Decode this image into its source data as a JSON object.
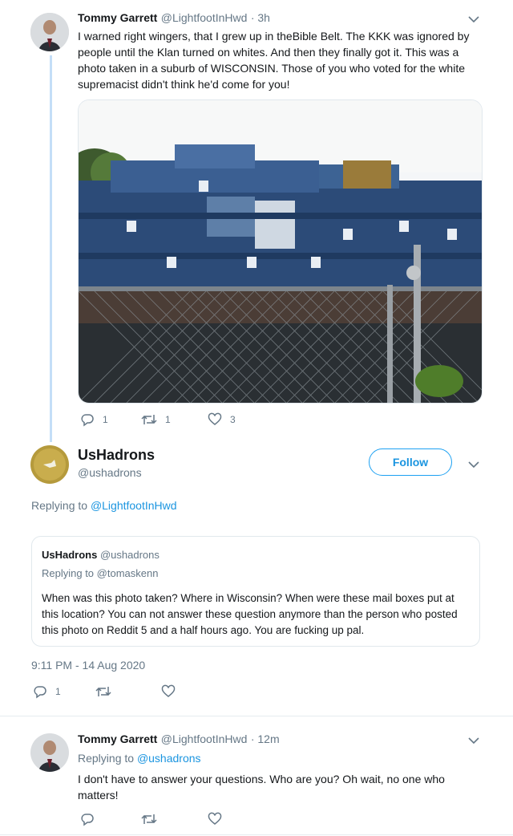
{
  "tweet1": {
    "name": "Tommy Garrett",
    "handle": "@LightfootInHwd",
    "time": "· 3h",
    "text": "I warned right wingers, that I grew up in theBible Belt.  The KKK was ignored by people until the Klan turned on whites. And then they finally got it. This was a photo taken in a suburb of WISCONSIN. Those of you who voted for the white supremacist didn't think he'd come for you!",
    "replies": "1",
    "retweets": "1",
    "likes": "3"
  },
  "main": {
    "name": "UsHadrons",
    "handle": "@ushadrons",
    "follow_label": "Follow",
    "replying_prefix": "Replying to",
    "replying_to": "@LightfootInHwd",
    "quote": {
      "name": "UsHadrons",
      "handle": "@ushadrons",
      "replying_prefix": "Replying to",
      "replying_to": "@tomaskenn",
      "text": "When was this photo taken? Where in Wisconsin? When were these mail boxes put at this location? You can not answer these question anymore than the person who posted this photo on Reddit 5 and a half hours ago. You are fucking up pal."
    },
    "timestamp": "9:11 PM - 14 Aug 2020",
    "replies": "1"
  },
  "tweet2": {
    "name": "Tommy Garrett",
    "handle": "@LightfootInHwd",
    "time": "· 12m",
    "replying_prefix": "Replying to",
    "replying_to": "@ushadrons",
    "text": "I don't have to answer your questions.  Who are you? Oh wait, no one who matters!"
  },
  "icons": [
    "reply-icon",
    "retweet-icon",
    "heart-icon",
    "chevron-down-icon"
  ],
  "colors": {
    "link": "#1b95e0",
    "gray": "#657786",
    "thread": "#c4def7",
    "follow_border": "#1da1f2"
  }
}
